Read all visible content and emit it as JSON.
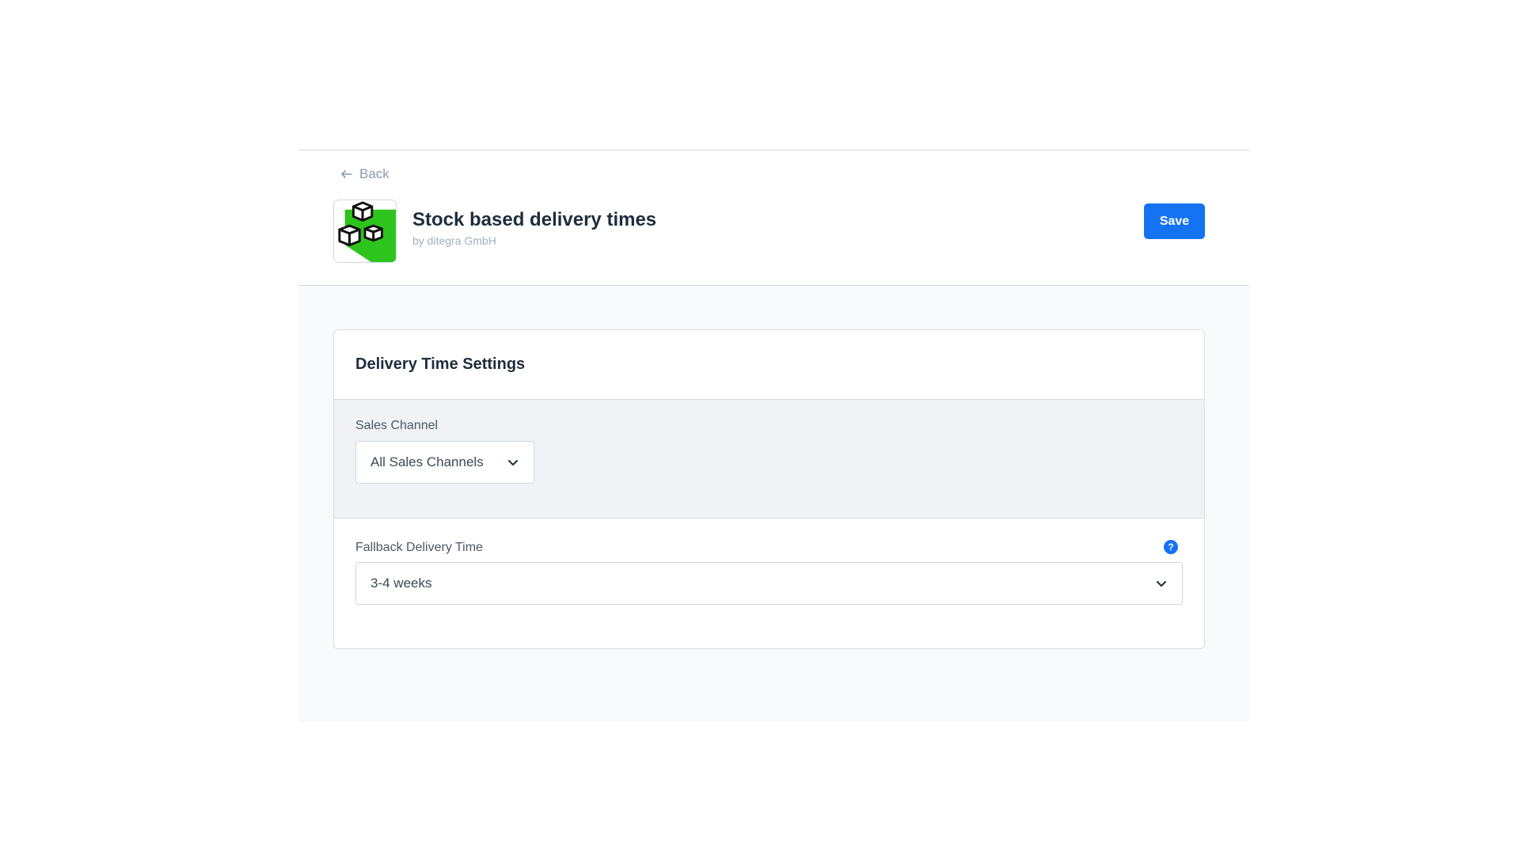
{
  "header": {
    "back_label": "Back",
    "app_title": "Stock based delivery times",
    "app_vendor": "by ditegra GmbH",
    "save_label": "Save"
  },
  "icons": {
    "back": "arrow-left-icon",
    "logo": "stacked-boxes-logo",
    "chevron": "chevron-down-icon",
    "help": "question-mark-icon"
  },
  "colors": {
    "primary": "#1573f3",
    "logo_green": "#2ec41e",
    "content_bg": "#f9fafb",
    "section_bg": "#f0f2f5"
  },
  "card": {
    "title": "Delivery Time Settings",
    "sales_channel": {
      "label": "Sales Channel",
      "selected": "All Sales Channels"
    },
    "fallback": {
      "label": "Fallback Delivery Time",
      "selected": "3-4 weeks",
      "help_glyph": "?"
    }
  }
}
